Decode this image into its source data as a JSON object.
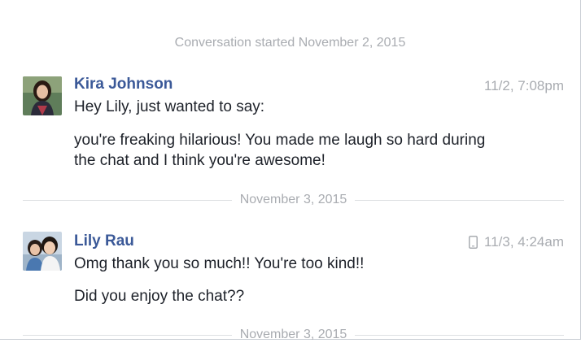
{
  "conversation": {
    "started_text": "Conversation started November 2, 2015"
  },
  "messages": [
    {
      "sender": "Kira Johnson",
      "timestamp": "11/2, 7:08pm",
      "lines": [
        "Hey Lily, just wanted to say:",
        "you're freaking hilarious! You made me laugh so hard during",
        "the chat and I think you're awesome!"
      ]
    },
    {
      "sender": "Lily Rau",
      "timestamp": "11/3, 4:24am",
      "timestamp_icon": "mobile-phone-icon",
      "lines": [
        "Omg thank you so much!! You're too kind!!",
        "Did you enjoy the chat??"
      ]
    }
  ],
  "dividers": [
    {
      "label": "November 3, 2015"
    },
    {
      "label": "November 3, 2015"
    }
  ],
  "colors": {
    "sender_name": "#3b5998",
    "meta_text": "#a9acb1",
    "message_text": "#1d2129",
    "divider_rule": "#dddfe2"
  }
}
